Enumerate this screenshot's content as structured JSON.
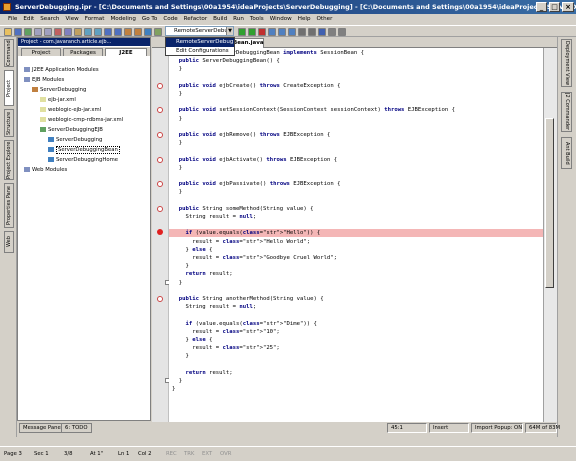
{
  "window": {
    "title": "ServerDebugging.ipr - [C:\\Documents and Settings\\00a1954\\ideaProjects\\ServerDebugging] - [C:\\Documents and Settings\\00a1954\\ideaProjects\\ServerDebugging\\src\\com\\javaranch\\arti...",
    "min": "_",
    "max": "□",
    "close": "×"
  },
  "menu": [
    "File",
    "Edit",
    "Search",
    "View",
    "Format",
    "Modeling",
    "Go To",
    "Code",
    "Refactor",
    "Build",
    "Run",
    "Tools",
    "Window",
    "Help",
    "Other"
  ],
  "toolbar": {
    "run_config": "RemoteServerDebug",
    "dropdown": [
      "RemoteServerDebug",
      "Edit Configurations"
    ]
  },
  "left_tabs": [
    "Commander",
    "Project",
    "Structure",
    "Project Explorer",
    "Properties Pane",
    "Web"
  ],
  "right_tabs": [
    "Deployment View",
    "J2 Commander",
    "Ant Build"
  ],
  "project": {
    "header": "Project - com.javaranch.article.ejb...",
    "tabs": [
      "Project",
      "Packages",
      "J2EE"
    ],
    "tree": [
      {
        "label": "J2EE Application Modules",
        "indent": 0
      },
      {
        "label": "EJB Modules",
        "indent": 0
      },
      {
        "label": "ServerDebugging",
        "indent": 1
      },
      {
        "label": "ejb-jar.xml",
        "indent": 2
      },
      {
        "label": "weblogic-ejb-jar.xml",
        "indent": 2
      },
      {
        "label": "weblogic-cmp-rdbms-jar.xml",
        "indent": 2
      },
      {
        "label": "ServerDebuggingEJB",
        "indent": 2
      },
      {
        "label": "ServerDebugging",
        "indent": 3
      },
      {
        "label": "ServerDebuggingBean",
        "indent": 3
      },
      {
        "label": "ServerDebuggingHome",
        "indent": 3
      },
      {
        "label": "Web Modules",
        "indent": 0
      }
    ]
  },
  "editor": {
    "tab": "Bean.java",
    "lines": [
      "public class ServerDebuggingBean implements SessionBean {",
      "  public ServerDebuggingBean() {",
      "  }",
      "",
      "  public void ejbCreate() throws CreateException {",
      "  }",
      "",
      "  public void setSessionContext(SessionContext sessionContext) throws EJBException {",
      "  }",
      "",
      "  public void ejbRemove() throws EJBException {",
      "  }",
      "",
      "  public void ejbActivate() throws EJBException {",
      "  }",
      "",
      "  public void ejbPassivate() throws EJBException {",
      "  }",
      "",
      "  public String someMethod(String value) {",
      "    String result = null;",
      "",
      "    if (value.equals(\"Hello\")) {",
      "      result = \"Hello World\";",
      "    } else {",
      "      result = \"Goodbye Cruel World\";",
      "    }",
      "    return result;",
      "  }",
      "",
      "  public String anotherMethod(String value) {",
      "    String result = null;",
      "",
      "    if (value.equals(\"Dime\")) {",
      "      result = \"10\";",
      "    } else {",
      "      result = \"25\";",
      "    }",
      "",
      "    return result;",
      "  }",
      "}"
    ],
    "breakpoint_line": 22
  },
  "bottom": {
    "tabs": [
      "Message Pane",
      "6: TODO"
    ],
    "position": "45:1",
    "mode": "Insert",
    "import_popup": "Import Popup: ON",
    "memory": "64M of 83M"
  },
  "status": [
    "Page 3",
    "Sec 1",
    "3/8",
    "At 1\"",
    "Ln 1",
    "Col 2",
    "REC",
    "TRK",
    "EXT",
    "OVR"
  ]
}
